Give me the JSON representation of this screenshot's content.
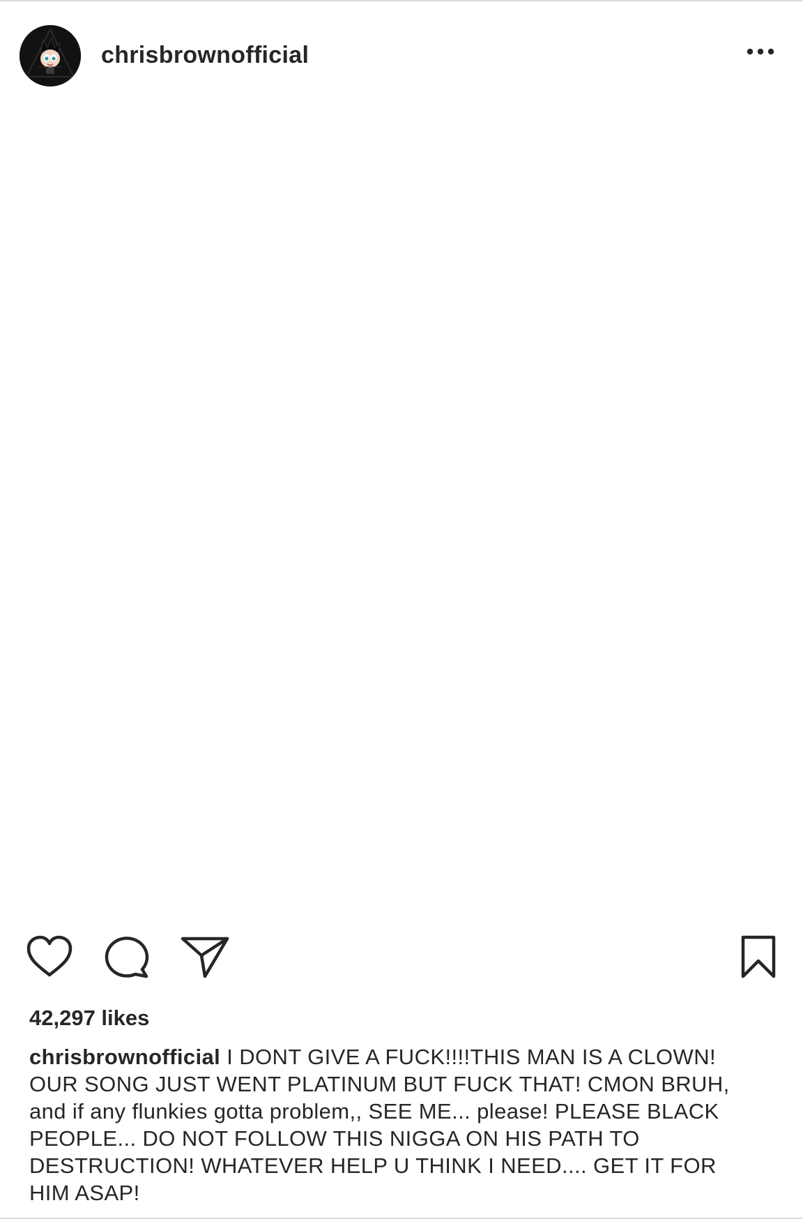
{
  "post": {
    "username": "chrisbrownofficial",
    "likes_text": "42,297 likes",
    "caption": {
      "username": "chrisbrownofficial",
      "text": " I DONT GIVE A FUCK!!!!THIS MAN IS A CLOWN!\nOUR SONG JUST WENT PLATINUM BUT FUCK THAT! CMON BRUH,\nand if any flunkies gotta problem,, SEE ME... please! PLEASE BLACK\nPEOPLE... DO NOT FOLLOW THIS NIGGA ON HIS PATH TO\nDESTRUCTION!  WHATEVER HELP U THINK I NEED.... GET IT FOR\nHIM ASAP!"
    }
  },
  "icons": {
    "avatar": "avatar-astro-boy",
    "more": "more-options-icon",
    "like": "heart-icon",
    "comment": "comment-icon",
    "share": "send-icon",
    "save": "bookmark-icon"
  },
  "colors": {
    "text": "#262626",
    "border": "#dbdbdb",
    "background": "#ffffff"
  }
}
